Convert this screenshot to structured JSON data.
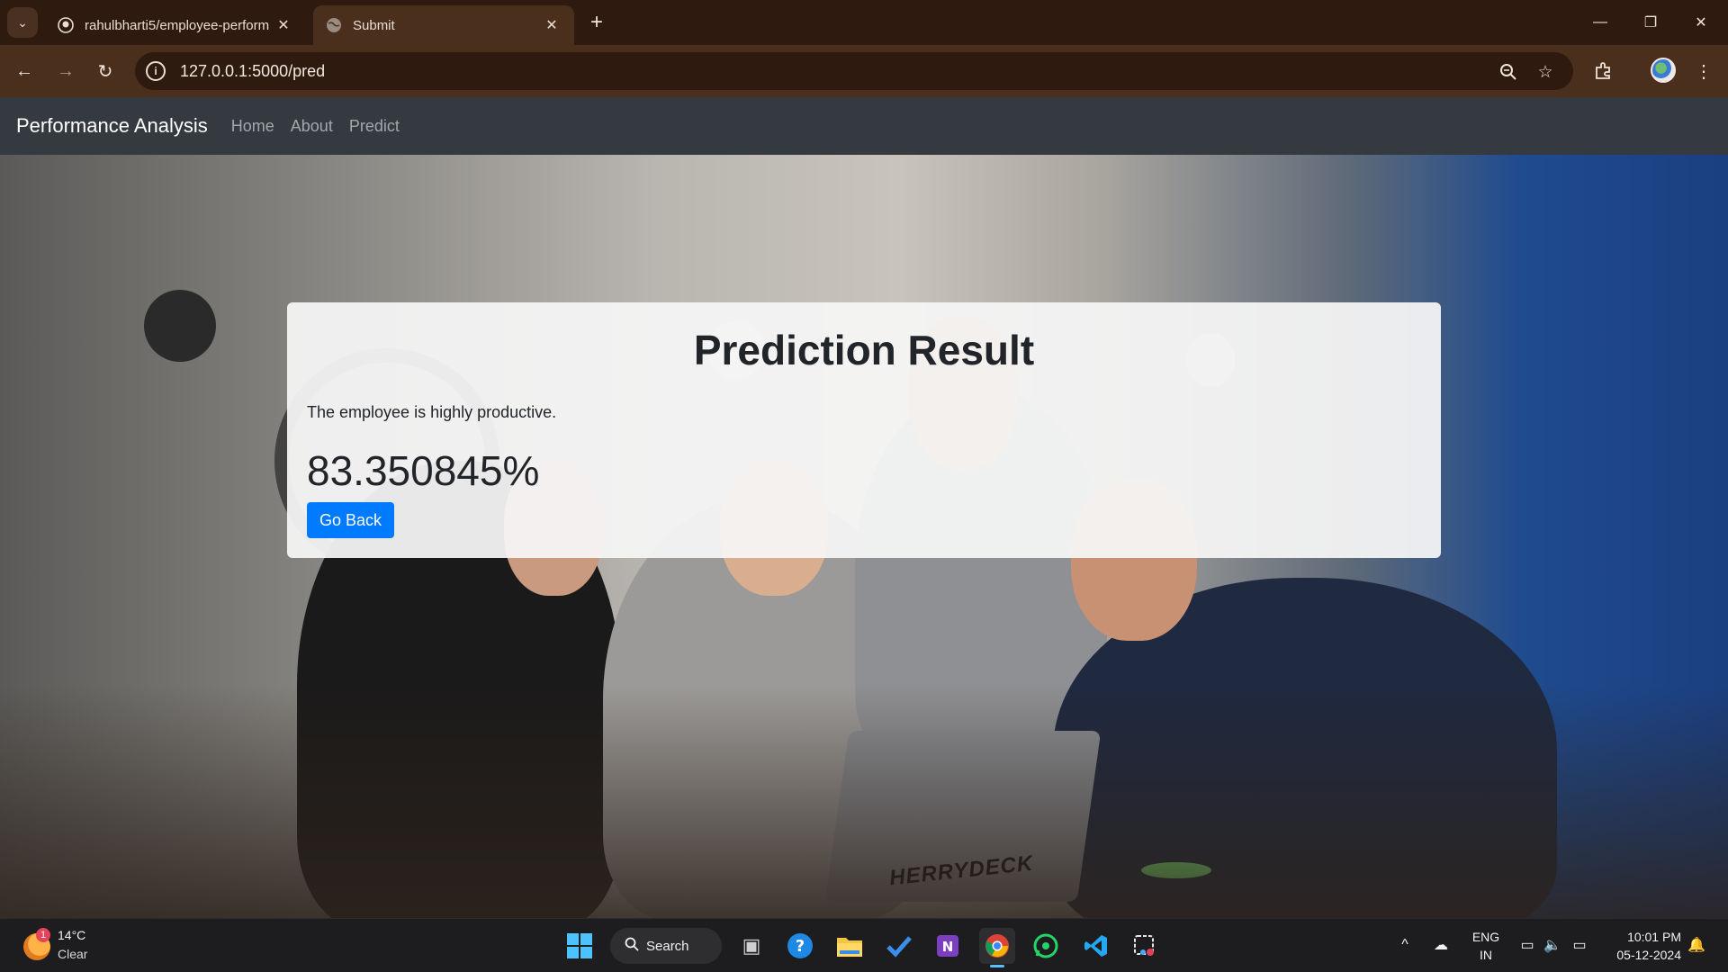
{
  "browser": {
    "tabs": [
      {
        "title": "rahulbharti5/employee-perform",
        "active": false,
        "favicon": "github-icon"
      },
      {
        "title": "Submit",
        "active": true,
        "favicon": "globe-icon"
      }
    ],
    "address_bar": {
      "url": "127.0.0.1:5000/pred"
    }
  },
  "site_nav": {
    "brand": "Performance Analysis",
    "links": [
      "Home",
      "About",
      "Predict"
    ]
  },
  "result": {
    "title": "Prediction Result",
    "message": "The employee is highly productive.",
    "value": "83.350845%",
    "button_label": "Go Back"
  },
  "taskbar": {
    "weather": {
      "temp": "14°C",
      "condition": "Clear",
      "badge": "1"
    },
    "search_label": "Search",
    "language": {
      "line1": "ENG",
      "line2": "IN"
    },
    "clock": {
      "time": "10:01 PM",
      "date": "05-12-2024"
    }
  },
  "colors": {
    "nav_bg": "#343a40",
    "button_primary": "#007bff",
    "chrome_frame": "#2e1a0e",
    "chrome_toolbar": "#4a2f1d"
  }
}
